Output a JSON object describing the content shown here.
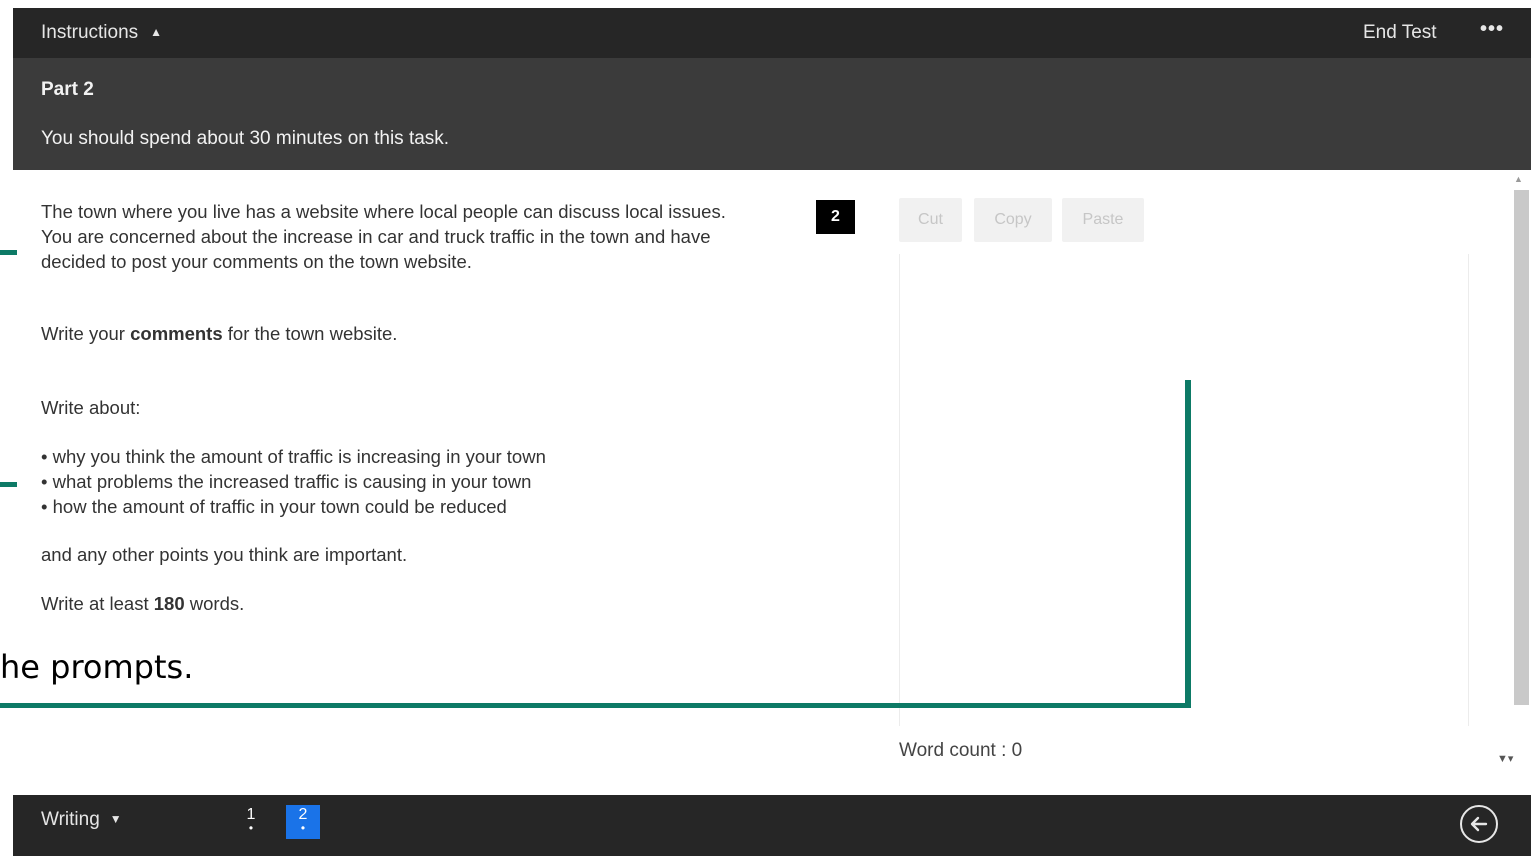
{
  "header": {
    "instructions_label": "Instructions",
    "end_test_label": "End Test",
    "more_label": "•••"
  },
  "part": {
    "title": "Part 2",
    "subtitle": "You should spend about 30 minutes on this task."
  },
  "prompt": {
    "intro": "The town where you live has a website where local people can discuss local issues. You are concerned about the increase in car and truck traffic in the town and have decided to post your comments on the town website.",
    "write_prefix": "Write your ",
    "write_bold": "comments",
    "write_suffix": " for the town website.",
    "write_about": "Write about:",
    "bullets": [
      "• why you think the amount of traffic is increasing in your town",
      "• what problems the increased traffic is causing in your town",
      "• how the amount of traffic in your town could be reduced"
    ],
    "other_points": "and any other points you think are important.",
    "min_prefix": "Write at least ",
    "min_bold": "180",
    "min_suffix": " words."
  },
  "question_number": "2",
  "editor": {
    "cut_label": "Cut",
    "copy_label": "Copy",
    "paste_label": "Paste",
    "answer_value": "",
    "word_count_label": "Word count : ",
    "word_count": "0"
  },
  "overlay": {
    "caption": "he prompts.",
    "color": "#0d7a66"
  },
  "footer": {
    "section_label": "Writing",
    "questions": [
      {
        "number": "1",
        "active": false
      },
      {
        "number": "2",
        "active": true
      }
    ],
    "active_color": "#1a73e8"
  },
  "icons": {
    "instructions_caret": "caret-up-icon",
    "section_caret": "caret-down-icon",
    "back": "arrow-left-circle-icon"
  }
}
